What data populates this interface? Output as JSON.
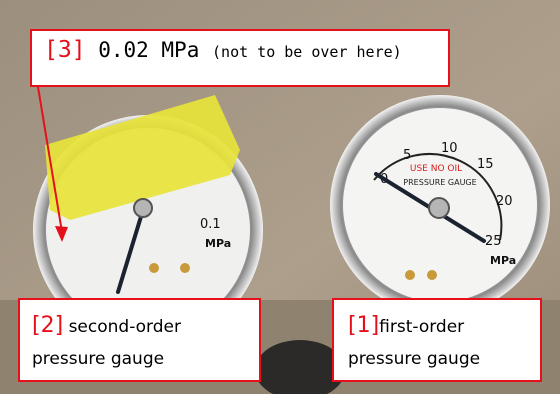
{
  "callouts": {
    "top": {
      "number": "[3]",
      "value": "0.02 MPa",
      "note": "(not to be over here)"
    },
    "left": {
      "number": "[2]",
      "line1": "second-order",
      "line2": "pressure gauge"
    },
    "right": {
      "number": "[1]",
      "line1": "first-order",
      "line2": "pressure gauge"
    }
  },
  "gauges": {
    "right": {
      "ticks": [
        "0",
        "5",
        "10",
        "15",
        "20",
        "25"
      ],
      "unit": "MPa",
      "label_line1": "USE NO OIL",
      "label_line2": "PRESSURE GAUGE"
    },
    "left": {
      "tick": "0.1",
      "unit": "MPa"
    }
  },
  "colors": {
    "callout_border": "#e5101a",
    "tape": "#e8e43a",
    "wall": "#a89a86"
  }
}
